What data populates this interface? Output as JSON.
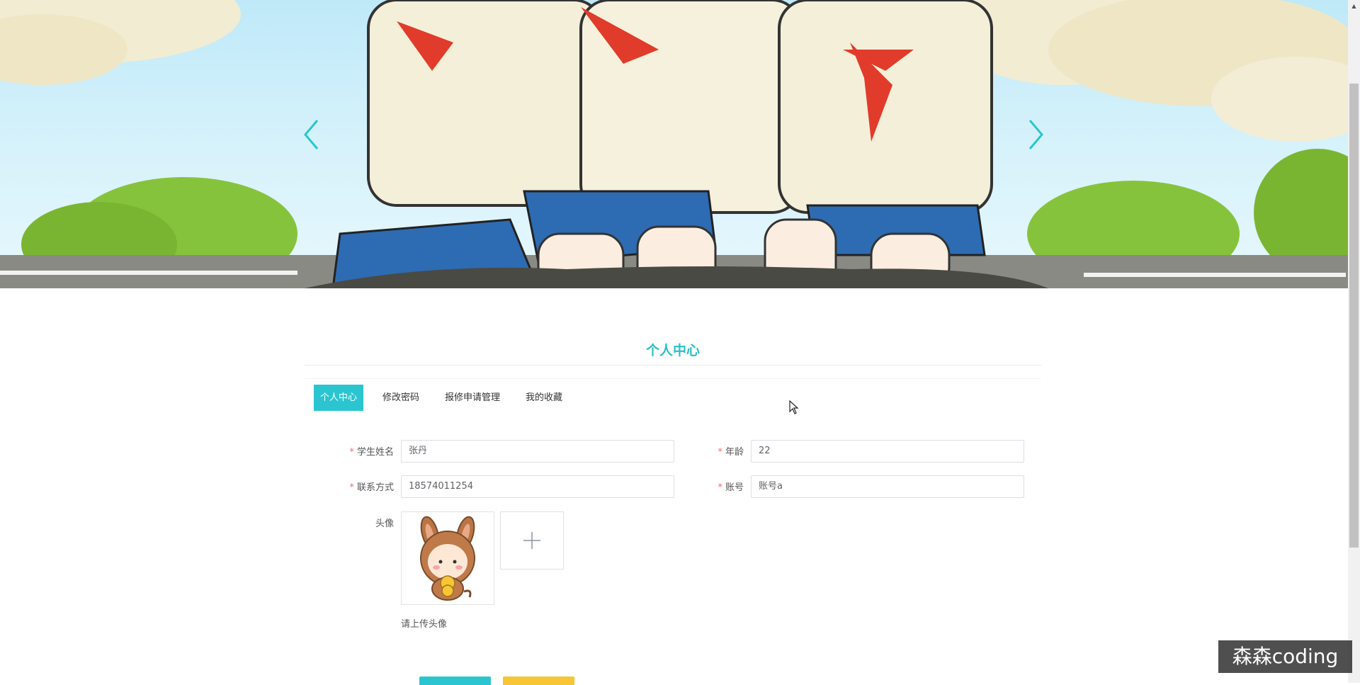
{
  "banner": {
    "prev_icon": "chevron-left-icon",
    "next_icon": "chevron-right-icon"
  },
  "page": {
    "title": "个人中心"
  },
  "tabs": [
    {
      "label": "个人中心",
      "active": true
    },
    {
      "label": "修改密码",
      "active": false
    },
    {
      "label": "报修申请管理",
      "active": false
    },
    {
      "label": "我的收藏",
      "active": false
    }
  ],
  "form": {
    "name_label": "学生姓名",
    "name_value": "张丹",
    "age_label": "年龄",
    "age_value": "22",
    "phone_label": "联系方式",
    "phone_value": "18574011254",
    "account_label": "账号",
    "account_value": "账号a",
    "avatar_label": "头像",
    "upload_tip": "请上传头像",
    "required_mark": "*"
  },
  "watermark": "森森coding",
  "colors": {
    "accent": "#2bc5d0",
    "warning": "#f6c634",
    "required": "#f56c6c"
  }
}
